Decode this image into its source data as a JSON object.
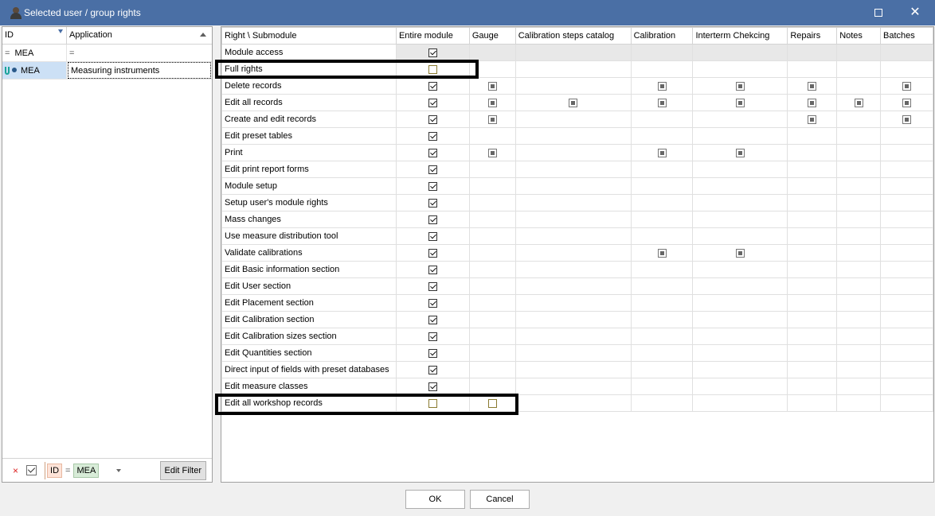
{
  "window": {
    "title": "Selected user / group rights"
  },
  "left": {
    "columns": [
      "ID",
      "Application"
    ],
    "filter_row": {
      "op_id": "=",
      "value_id": "MEA",
      "op_app": "="
    },
    "rows": [
      {
        "id": "MEA",
        "application": "Measuring instruments"
      }
    ],
    "footer": {
      "clear": "×",
      "field": "ID",
      "op": "=",
      "value": "MEA",
      "edit_filter": "Edit Filter"
    }
  },
  "grid": {
    "columns": [
      "Right \\ Submodule",
      "Entire module",
      "Gauge",
      "Calibration steps catalog",
      "Calibration",
      "Interterm Chekcing",
      "Repairs",
      "Notes",
      "Batches"
    ],
    "rows": [
      {
        "label": "Module access",
        "states": [
          "on",
          "",
          "",
          "",
          "",
          "",
          "",
          ""
        ],
        "gray": true
      },
      {
        "label": "Full rights",
        "states": [
          "off",
          "",
          "",
          "",
          "",
          "",
          "",
          ""
        ]
      },
      {
        "label": "Delete records",
        "states": [
          "on",
          "ind",
          "",
          "ind",
          "ind",
          "ind",
          "",
          "ind"
        ]
      },
      {
        "label": "Edit all records",
        "states": [
          "on",
          "ind",
          "ind",
          "ind",
          "ind",
          "ind",
          "ind",
          "ind"
        ]
      },
      {
        "label": "Create and edit records",
        "states": [
          "on",
          "ind",
          "",
          "",
          "",
          "ind",
          "",
          "ind"
        ]
      },
      {
        "label": "Edit preset tables",
        "states": [
          "on",
          "",
          "",
          "",
          "",
          "",
          "",
          ""
        ]
      },
      {
        "label": "Print",
        "states": [
          "on",
          "ind",
          "",
          "ind",
          "ind",
          "",
          "",
          ""
        ]
      },
      {
        "label": "Edit print report forms",
        "states": [
          "on",
          "",
          "",
          "",
          "",
          "",
          "",
          ""
        ]
      },
      {
        "label": "Module setup",
        "states": [
          "on",
          "",
          "",
          "",
          "",
          "",
          "",
          ""
        ]
      },
      {
        "label": "Setup user's module rights",
        "states": [
          "on",
          "",
          "",
          "",
          "",
          "",
          "",
          ""
        ]
      },
      {
        "label": "Mass changes",
        "states": [
          "on",
          "",
          "",
          "",
          "",
          "",
          "",
          ""
        ]
      },
      {
        "label": "Use measure distribution tool",
        "states": [
          "on",
          "",
          "",
          "",
          "",
          "",
          "",
          ""
        ]
      },
      {
        "label": "Validate calibrations",
        "states": [
          "on",
          "",
          "",
          "ind",
          "ind",
          "",
          "",
          ""
        ]
      },
      {
        "label": "Edit Basic information section",
        "states": [
          "on",
          "",
          "",
          "",
          "",
          "",
          "",
          ""
        ]
      },
      {
        "label": "Edit User section",
        "states": [
          "on",
          "",
          "",
          "",
          "",
          "",
          "",
          ""
        ]
      },
      {
        "label": "Edit Placement section",
        "states": [
          "on",
          "",
          "",
          "",
          "",
          "",
          "",
          ""
        ]
      },
      {
        "label": "Edit Calibration section",
        "states": [
          "on",
          "",
          "",
          "",
          "",
          "",
          "",
          ""
        ]
      },
      {
        "label": "Edit Calibration sizes section",
        "states": [
          "on",
          "",
          "",
          "",
          "",
          "",
          "",
          ""
        ]
      },
      {
        "label": "Edit Quantities section",
        "states": [
          "on",
          "",
          "",
          "",
          "",
          "",
          "",
          ""
        ]
      },
      {
        "label": "Direct input of fields with preset databases",
        "states": [
          "on",
          "",
          "",
          "",
          "",
          "",
          "",
          ""
        ]
      },
      {
        "label": "Edit measure classes",
        "states": [
          "on",
          "",
          "",
          "",
          "",
          "",
          "",
          ""
        ]
      },
      {
        "label": "Edit all workshop records",
        "states": [
          "off",
          "off",
          "",
          "",
          "",
          "",
          "",
          ""
        ]
      }
    ]
  },
  "buttons": {
    "ok": "OK",
    "cancel": "Cancel"
  }
}
